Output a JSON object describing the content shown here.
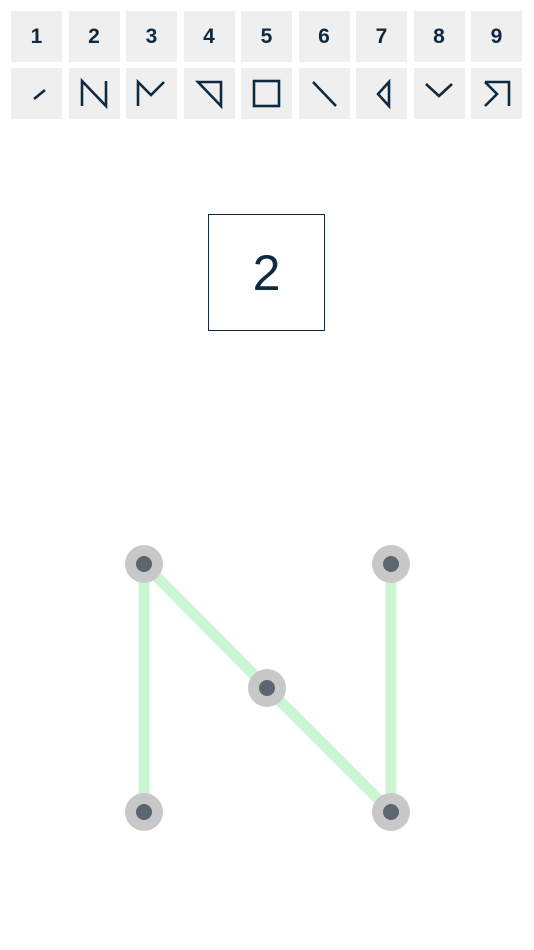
{
  "legend": {
    "numbers": [
      "1",
      "2",
      "3",
      "4",
      "5",
      "6",
      "7",
      "8",
      "9"
    ],
    "glyph_icons": [
      "short-diagonal-stroke-icon",
      "n-shape-icon",
      "m-shape-icon",
      "right-triangle-icon",
      "square-icon",
      "diagonal-down-stroke-icon",
      "left-arrowhead-icon",
      "check-v-icon",
      "reversed-z-icon"
    ]
  },
  "target": {
    "digit": "2"
  },
  "pad": {
    "dot_color": "#5c6670",
    "halo_color": "#c8c8c8",
    "line_color": "#ccf5d4",
    "path_order": [
      "bottom-left",
      "top-left",
      "center",
      "bottom-right",
      "top-right"
    ]
  }
}
